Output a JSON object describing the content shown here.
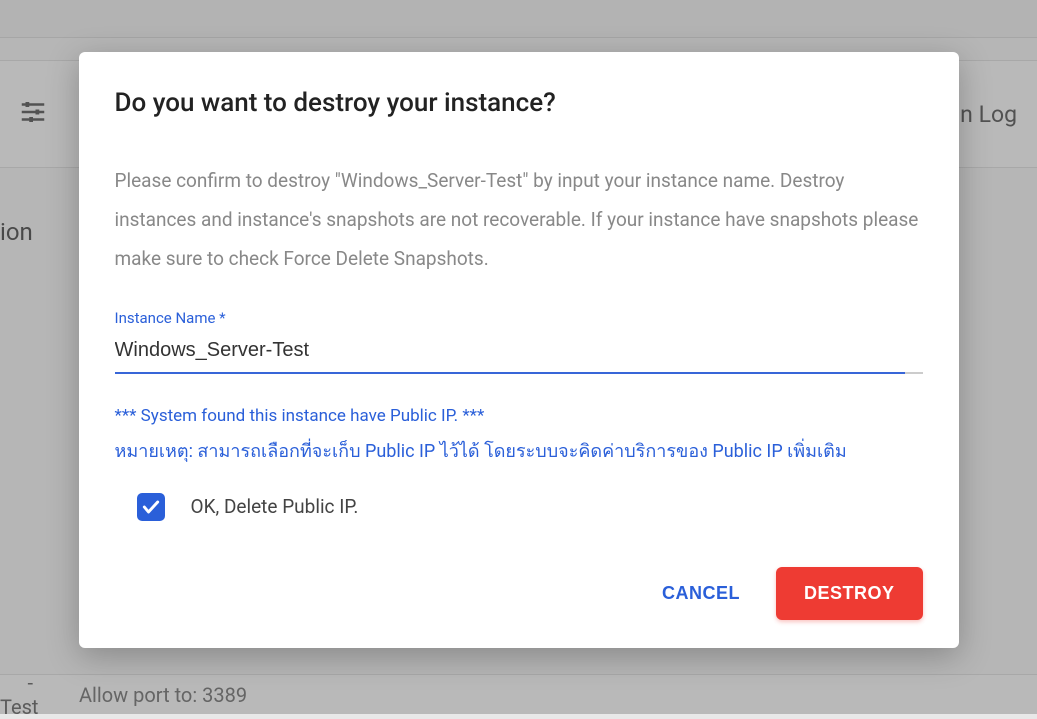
{
  "background": {
    "menubar_right_text": "n Log",
    "sidebar_text": "ion",
    "bottom_left": "-Test",
    "bottom_right": "Allow port to: 3389"
  },
  "dialog": {
    "title": "Do you want to destroy your instance?",
    "description": "Please confirm to destroy \"Windows_Server-Test\" by input your instance name. Destroy instances and instance's snapshots are not recoverable. If your instance have snapshots please make sure to check Force Delete Snapshots.",
    "input": {
      "label": "Instance Name *",
      "value": "Windows_Server-Test"
    },
    "notice_english": "*** System found this instance have Public IP. ***",
    "notice_thai": "หมายเหตุ: สามารถเลือกที่จะเก็บ Public IP ไว้ได้ โดยระบบจะคิดค่าบริการของ Public IP เพิ่มเติม",
    "checkbox": {
      "label": "OK, Delete Public IP.",
      "checked": true
    },
    "actions": {
      "cancel": "CANCEL",
      "destroy": "DESTROY"
    }
  }
}
